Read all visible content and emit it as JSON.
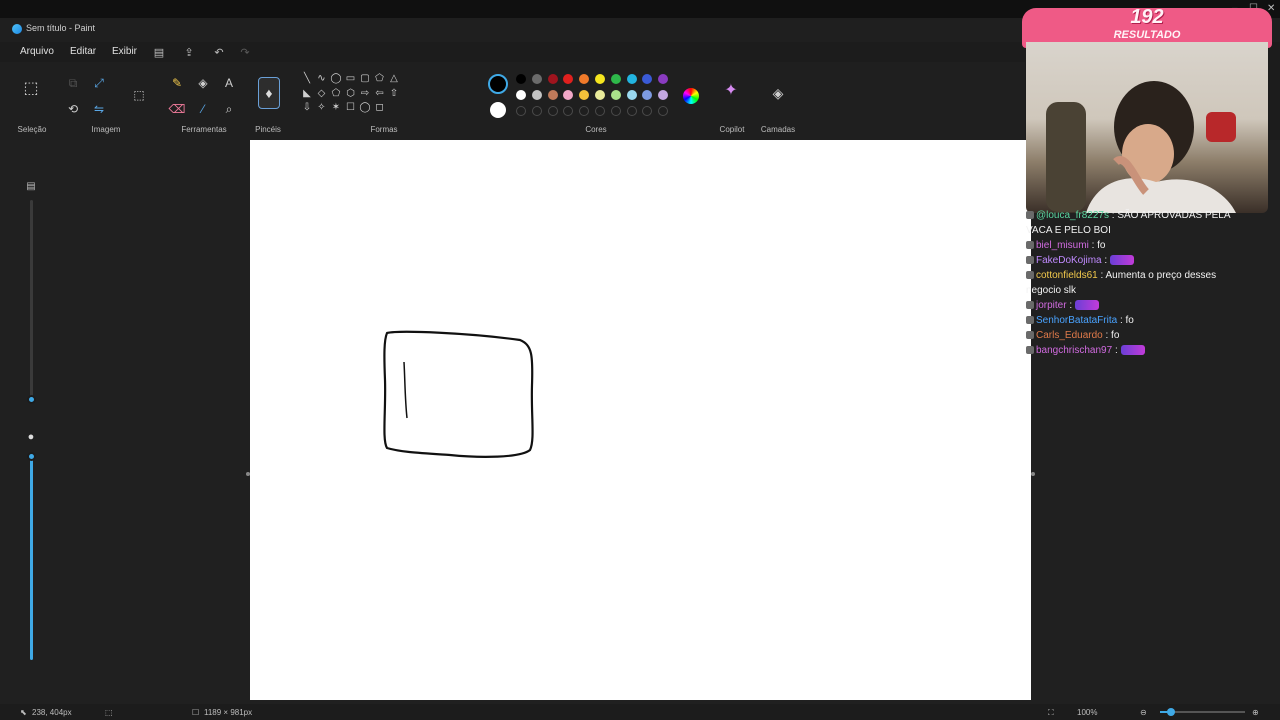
{
  "window": {
    "title": "Sem título - Paint",
    "min_glyph": "–",
    "max_glyph": "☐",
    "close_glyph": "✕"
  },
  "menu": {
    "file": "Arquivo",
    "edit": "Editar",
    "view": "Exibir",
    "save_icon": "▤",
    "share_icon": "⇪",
    "undo_icon": "↶",
    "redo_icon": "↷"
  },
  "ribbon": {
    "groups": {
      "selection": "Seleção",
      "image": "Imagem",
      "tools": "Ferramentas",
      "brushes": "Pincéis",
      "shapes": "Formas",
      "colors": "Cores",
      "copilot": "Copilot",
      "layers": "Camadas"
    },
    "icons": {
      "selection": "⬚",
      "crop": "⧉",
      "resize": "⤢",
      "rotate": "⟲",
      "flip": "⇋",
      "pencil": "✎",
      "fill": "◈",
      "text": "A",
      "eraser": "⌫",
      "picker": "⁄",
      "zoom": "⌕",
      "brush": "♦",
      "copilot": "✦",
      "layers": "◈"
    },
    "shapes": [
      "╲",
      "∿",
      "◯",
      "▭",
      "▢",
      "⬠",
      "△",
      "◣",
      "◇",
      "⬠",
      "⬡",
      "⇨",
      "⇦",
      "⇧",
      "⇩",
      "✧",
      "✶",
      "☐",
      "◯",
      "◻"
    ],
    "colors": {
      "primary": "#000000",
      "secondary": "#ffffff",
      "row1": [
        "#000000",
        "#6b6b6b",
        "#a0141e",
        "#e0201e",
        "#f07a2a",
        "#f5e51f",
        "#2eb84a",
        "#22b4e0",
        "#3a5ad6",
        "#8a3bc0"
      ],
      "row2": [
        "#ffffff",
        "#c4c4c4",
        "#c07a5a",
        "#f2a8c8",
        "#f5c23a",
        "#e9ea9a",
        "#a9e08a",
        "#9ad8ef",
        "#7d9ae0",
        "#c3a7e0"
      ]
    }
  },
  "status": {
    "cursor_pos": "238, 404px",
    "canvas_size": "1189 × 981px",
    "zoom": "100%"
  },
  "overlay": {
    "count": "192",
    "label": "RESULTADO"
  },
  "chat": {
    "lines": [
      {
        "user": "@louca_fr8227s",
        "text": " : SÃO APROVADAS PELA",
        "color": "#5bd6a0"
      },
      {
        "user": "",
        "text": "VACA E PELO BOI",
        "color": "#f2f2f2"
      },
      {
        "user": "biel_misumi",
        "text": " : fo",
        "color": "#d16be0"
      },
      {
        "user": "FakeDoKojima",
        "text": " : ",
        "color": "#c08aff"
      },
      {
        "user": "cottonfields61",
        "text": " : Aumenta o preço desses",
        "color": "#f2c94c"
      },
      {
        "user": "",
        "text": "negocio slk",
        "color": "#f2f2f2"
      },
      {
        "user": "jorpiter",
        "text": " : ",
        "color": "#d16be0"
      },
      {
        "user": "SenhorBatataFrita",
        "text": " : fo",
        "color": "#4aa3ff"
      },
      {
        "user": "Carls_Eduardo",
        "text": " : fo",
        "color": "#e07a4a"
      },
      {
        "user": "bangchrischan97",
        "text": " : ",
        "color": "#d16be0"
      }
    ]
  }
}
